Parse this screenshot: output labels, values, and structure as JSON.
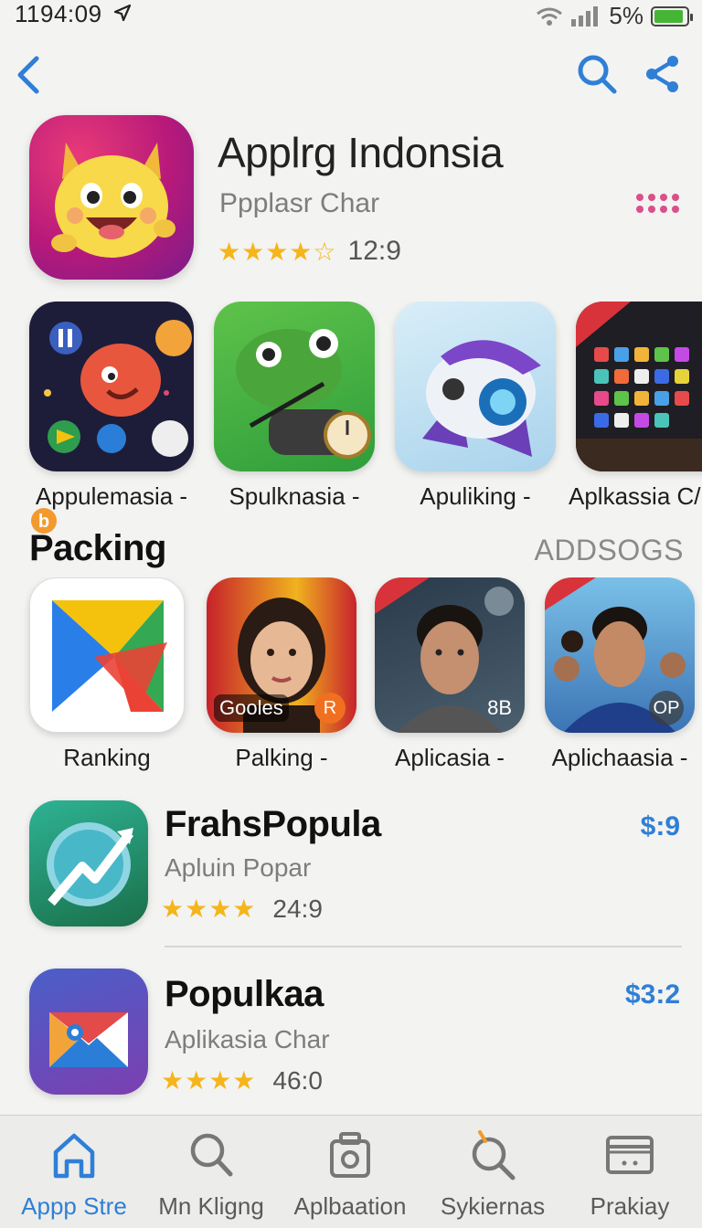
{
  "status_bar": {
    "time": "1194:09",
    "battery_pct": "5%",
    "battery_level": 0.9
  },
  "hero": {
    "title": "Applrg Indonsia",
    "subtitle": "Ppplasr Char",
    "rating_value": "12:9",
    "stars": 4
  },
  "featured": [
    {
      "label": "Appulemasia -"
    },
    {
      "label": "Spulknasia -"
    },
    {
      "label": "Apuliking -"
    },
    {
      "label": "Aplkassia C/"
    }
  ],
  "section": {
    "title": "Packing",
    "action": "ADDSOGS"
  },
  "ranking": [
    {
      "label": "Ranking",
      "badge": ""
    },
    {
      "label": "Palking -",
      "badge": "Gooles",
      "badge2": "R"
    },
    {
      "label": "Aplicasia -",
      "badge": "8B"
    },
    {
      "label": "Aplichaasia -",
      "badge": "OP"
    }
  ],
  "list": [
    {
      "name": "FrahsPopula",
      "category": "Apluin Popar",
      "rating": "24:9",
      "price": "$:9"
    },
    {
      "name": "Populkaa",
      "category": "Aplikasia Char",
      "rating": "46:0",
      "price": "$3:2"
    }
  ],
  "tabs": [
    {
      "label": "Appp Stre",
      "icon": "home-icon"
    },
    {
      "label": "Mn Kligng",
      "icon": "search-icon"
    },
    {
      "label": "Aplbaation",
      "icon": "camera-icon"
    },
    {
      "label": "Sykiernas",
      "icon": "search-icon"
    },
    {
      "label": "Prakiay",
      "icon": "wallet-icon"
    }
  ],
  "colors": {
    "accent": "#2f7fd6",
    "star": "#f5b51b",
    "battery": "#46b536"
  }
}
